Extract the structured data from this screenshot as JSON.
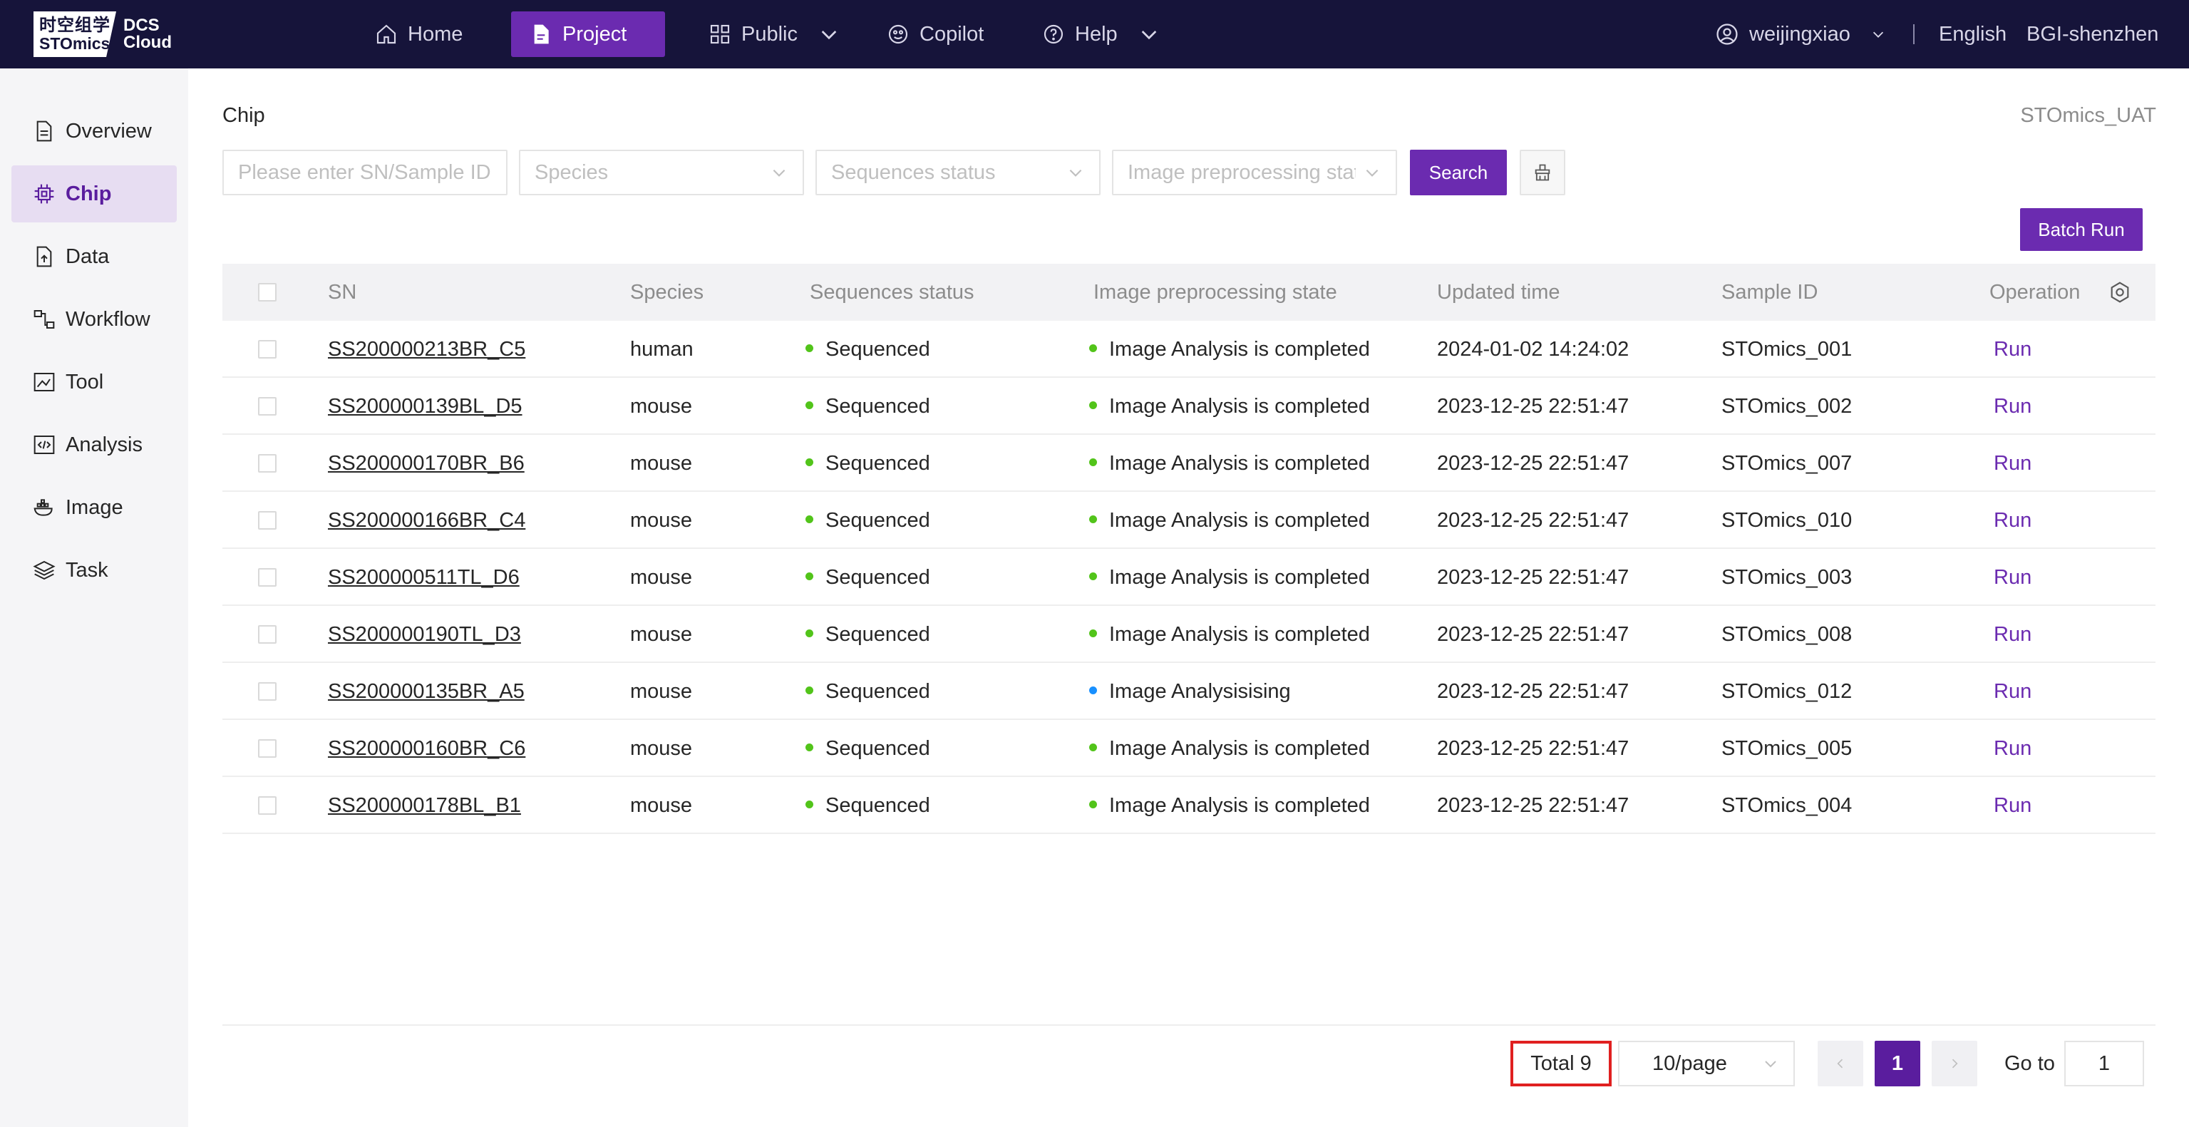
{
  "topbar": {
    "logo": {
      "line1": "时空组学",
      "line2": "STOmics",
      "product_line1": "DCS",
      "product_line2": "Cloud"
    },
    "nav": [
      {
        "label": "Home",
        "icon": "home-icon"
      },
      {
        "label": "Project",
        "icon": "document-icon",
        "active": true
      },
      {
        "label": "Public",
        "icon": "grid-icon",
        "has_dropdown": true
      },
      {
        "label": "Copilot",
        "icon": "copilot-icon"
      },
      {
        "label": "Help",
        "icon": "help-icon",
        "has_dropdown": true
      }
    ],
    "user": "weijingxiao",
    "language": "English",
    "region": "BGI-shenzhen"
  },
  "sidebar": {
    "items": [
      {
        "label": "Overview",
        "icon": "overview-icon"
      },
      {
        "label": "Chip",
        "icon": "chip-icon",
        "active": true
      },
      {
        "label": "Data",
        "icon": "data-icon"
      },
      {
        "label": "Workflow",
        "icon": "workflow-icon"
      },
      {
        "label": "Tool",
        "icon": "tool-icon"
      },
      {
        "label": "Analysis",
        "icon": "analysis-icon"
      },
      {
        "label": "Image",
        "icon": "image-icon"
      },
      {
        "label": "Task",
        "icon": "task-icon"
      }
    ]
  },
  "page": {
    "title": "Chip",
    "env": "STOmics_UAT"
  },
  "filters": {
    "sn_placeholder": "Please enter SN/Sample ID",
    "species_placeholder": "Species",
    "seq_status_placeholder": "Sequences status",
    "image_state_placeholder": "Image preprocessing stat",
    "search_label": "Search",
    "batch_run_label": "Batch Run"
  },
  "table": {
    "columns": [
      "SN",
      "Species",
      "Sequences status",
      "Image preprocessing state",
      "Updated time",
      "Sample ID",
      "Operation"
    ],
    "rows": [
      {
        "sn": "SS200000213BR_C5",
        "species": "human",
        "seq": "Sequenced",
        "image": "Image Analysis is completed",
        "image_status_color": "#52c41a",
        "updated": "2024-01-02 14:24:02",
        "sample": "STOmics_001",
        "op": "Run"
      },
      {
        "sn": "SS200000139BL_D5",
        "species": "mouse",
        "seq": "Sequenced",
        "image": "Image Analysis is completed",
        "image_status_color": "#52c41a",
        "updated": "2023-12-25 22:51:47",
        "sample": "STOmics_002",
        "op": "Run"
      },
      {
        "sn": "SS200000170BR_B6",
        "species": "mouse",
        "seq": "Sequenced",
        "image": "Image Analysis is completed",
        "image_status_color": "#52c41a",
        "updated": "2023-12-25 22:51:47",
        "sample": "STOmics_007",
        "op": "Run"
      },
      {
        "sn": "SS200000166BR_C4",
        "species": "mouse",
        "seq": "Sequenced",
        "image": "Image Analysis is completed",
        "image_status_color": "#52c41a",
        "updated": "2023-12-25 22:51:47",
        "sample": "STOmics_010",
        "op": "Run"
      },
      {
        "sn": "SS200000511TL_D6",
        "species": "mouse",
        "seq": "Sequenced",
        "image": "Image Analysis is completed",
        "image_status_color": "#52c41a",
        "updated": "2023-12-25 22:51:47",
        "sample": "STOmics_003",
        "op": "Run"
      },
      {
        "sn": "SS200000190TL_D3",
        "species": "mouse",
        "seq": "Sequenced",
        "image": "Image Analysis is completed",
        "image_status_color": "#52c41a",
        "updated": "2023-12-25 22:51:47",
        "sample": "STOmics_008",
        "op": "Run"
      },
      {
        "sn": "SS200000135BR_A5",
        "species": "mouse",
        "seq": "Sequenced",
        "image": "Image Analysisising",
        "image_status_color": "#1890ff",
        "updated": "2023-12-25 22:51:47",
        "sample": "STOmics_012",
        "op": "Run"
      },
      {
        "sn": "SS200000160BR_C6",
        "species": "mouse",
        "seq": "Sequenced",
        "image": "Image Analysis is completed",
        "image_status_color": "#52c41a",
        "updated": "2023-12-25 22:51:47",
        "sample": "STOmics_005",
        "op": "Run"
      },
      {
        "sn": "SS200000178BL_B1",
        "species": "mouse",
        "seq": "Sequenced",
        "image": "Image Analysis is completed",
        "image_status_color": "#52c41a",
        "updated": "2023-12-25 22:51:47",
        "sample": "STOmics_004",
        "op": "Run"
      }
    ]
  },
  "pagination": {
    "total": "Total 9",
    "page_size": "10/page",
    "current_page": "1",
    "goto_label": "Go to",
    "goto_value": "1"
  },
  "colors": {
    "accent": "#6b2bb0",
    "topbar_bg": "#16143a",
    "status_green": "#52c41a",
    "status_blue": "#1890ff",
    "highlight_red": "#e02020"
  }
}
